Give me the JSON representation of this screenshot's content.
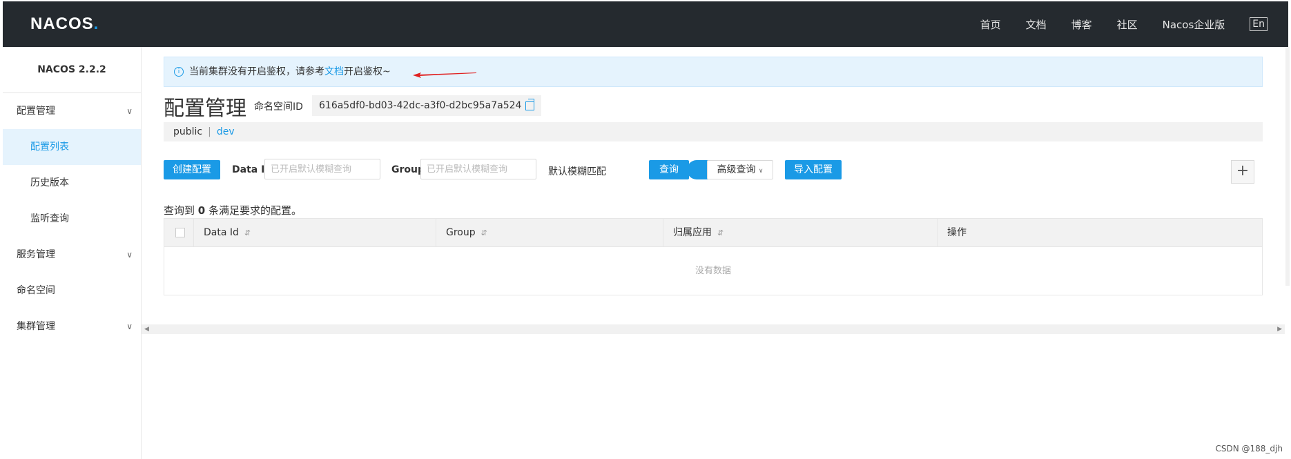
{
  "header": {
    "logo": "NACOS",
    "logo_dot": ".",
    "nav": [
      "首页",
      "文档",
      "博客",
      "社区",
      "Nacos企业版"
    ],
    "lang": "En"
  },
  "sidebar": {
    "version": "NACOS 2.2.2",
    "items": [
      {
        "label": "配置管理",
        "type": "group"
      },
      {
        "label": "配置列表",
        "type": "sub",
        "active": true
      },
      {
        "label": "历史版本",
        "type": "sub"
      },
      {
        "label": "监听查询",
        "type": "sub"
      },
      {
        "label": "服务管理",
        "type": "group"
      },
      {
        "label": "命名空间",
        "type": "group-plain"
      },
      {
        "label": "集群管理",
        "type": "group"
      }
    ]
  },
  "alert": {
    "prefix": "当前集群没有开启鉴权，请参考",
    "link": "文档",
    "suffix": "开启鉴权~"
  },
  "page": {
    "title": "配置管理",
    "ns_label": "命名空间ID",
    "ns_value": "616a5df0-bd03-42dc-a3f0-d2bc95a7a524",
    "ns_public": "public",
    "ns_sep": "|",
    "ns_dev": "dev"
  },
  "toolbar": {
    "create_label": "创建配置",
    "dataid_label": "Data ID",
    "dataid_placeholder": "已开启默认模糊查询",
    "group_label": "Group",
    "group_placeholder": "已开启默认模糊查询",
    "fuzzy_label": "默认模糊匹配",
    "query_label": "查询",
    "advanced_label": "高级查询",
    "import_label": "导入配置",
    "plus": "+"
  },
  "result": {
    "prefix": "查询到",
    "count": "0",
    "suffix": "条满足要求的配置。"
  },
  "table": {
    "columns": [
      "Data Id",
      "Group",
      "归属应用",
      "操作"
    ],
    "sort_glyph": "⇵",
    "empty": "没有数据"
  },
  "watermark": "CSDN @188_djh",
  "colors": {
    "accent": "#1a9ae6",
    "header_bg": "#252a2f"
  }
}
